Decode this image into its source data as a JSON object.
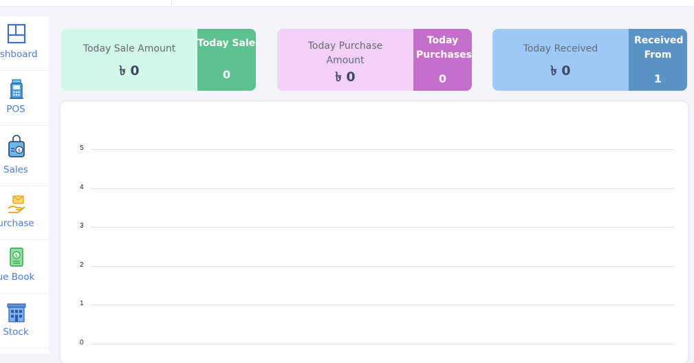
{
  "sidebar": {
    "items": [
      {
        "label": "ashboard",
        "icon": "dashboard-icon"
      },
      {
        "label": "POS",
        "icon": "pos-terminal-icon"
      },
      {
        "label": "Sales",
        "icon": "shopping-bag-icon"
      },
      {
        "label": "urchase",
        "icon": "purchase-hand-icon"
      },
      {
        "label": "ue Book",
        "icon": "due-book-icon"
      },
      {
        "label": "Stock",
        "icon": "stock-building-icon"
      }
    ]
  },
  "cards": {
    "sale": {
      "title": "Today Sale Amount",
      "amount": "৳ 0",
      "side_title": "Today Sales",
      "count": "0",
      "bg": "#d2f6e8",
      "side_bg": "#5cc08f"
    },
    "purchase": {
      "title": "Today Purchase Amount",
      "amount": "৳ 0",
      "side_title": "Today Purchases",
      "count": "0",
      "bg": "#f3d1f5",
      "side_bg": "#c66ecb"
    },
    "received": {
      "title": "Today Received",
      "amount": "৳ 0",
      "side_title": "Received From",
      "count": "1",
      "bg": "#9ec8f7",
      "side_bg": "#5a93c4"
    }
  },
  "chart_data": {
    "type": "bar",
    "categories": [],
    "series": [],
    "ylim": [
      0,
      5
    ],
    "yticks": [
      "5",
      "4",
      "3",
      "2",
      "1",
      "0"
    ],
    "grid": true,
    "legend": "none"
  }
}
